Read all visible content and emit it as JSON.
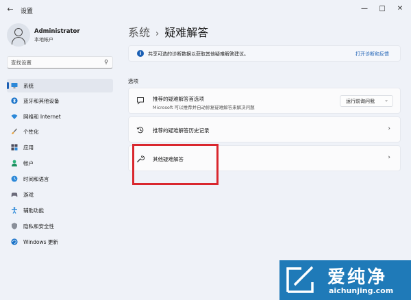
{
  "window": {
    "back_glyph": "←",
    "title": "设置",
    "controls": [
      "—",
      "□",
      "✕"
    ]
  },
  "profile": {
    "name": "Administrator",
    "subtitle": "本地帐户"
  },
  "search": {
    "placeholder": "查找设置"
  },
  "sidebar": {
    "items": [
      {
        "label": "系统",
        "icon": "monitor-icon",
        "active": true
      },
      {
        "label": "蓝牙和其他设备",
        "icon": "bluetooth-icon"
      },
      {
        "label": "网络和 Internet",
        "icon": "wifi-icon"
      },
      {
        "label": "个性化",
        "icon": "brush-icon"
      },
      {
        "label": "应用",
        "icon": "apps-icon"
      },
      {
        "label": "帐户",
        "icon": "person-icon"
      },
      {
        "label": "时间和语言",
        "icon": "globe-clock-icon"
      },
      {
        "label": "游戏",
        "icon": "gamepad-icon"
      },
      {
        "label": "辅助功能",
        "icon": "accessibility-icon"
      },
      {
        "label": "隐私和安全性",
        "icon": "shield-icon"
      },
      {
        "label": "Windows 更新",
        "icon": "update-icon"
      }
    ]
  },
  "breadcrumb": {
    "parent": "系统",
    "separator": "›",
    "current": "疑难解答"
  },
  "info_bar": {
    "icon_glyph": "i",
    "text": "共享可选的诊断数据以获取其他疑难解答建议。",
    "link": "打开诊断和反馈"
  },
  "options": {
    "section_label": "选项",
    "cards": [
      {
        "title": "推荐的疑难解答首选项",
        "subtitle": "Microsoft 可以推荐并自动修复疑难解答来解决问题",
        "dropdown_value": "运行前询问我",
        "icon": "chat-bubble-icon"
      },
      {
        "title": "推荐的疑难解答历史记录",
        "icon": "history-icon"
      },
      {
        "title": "其他疑难解答",
        "icon": "wrench-icon"
      }
    ],
    "chevron": "›",
    "caret": "⌄"
  },
  "watermark": {
    "title": "爱纯净",
    "url": "aichunjing.com"
  },
  "colors": {
    "accent": "#1a5fb4",
    "background": "#eff2f8",
    "card": "#fbfbfc",
    "highlight": "#d9272e",
    "watermark_bg": "#1f7ab8"
  }
}
